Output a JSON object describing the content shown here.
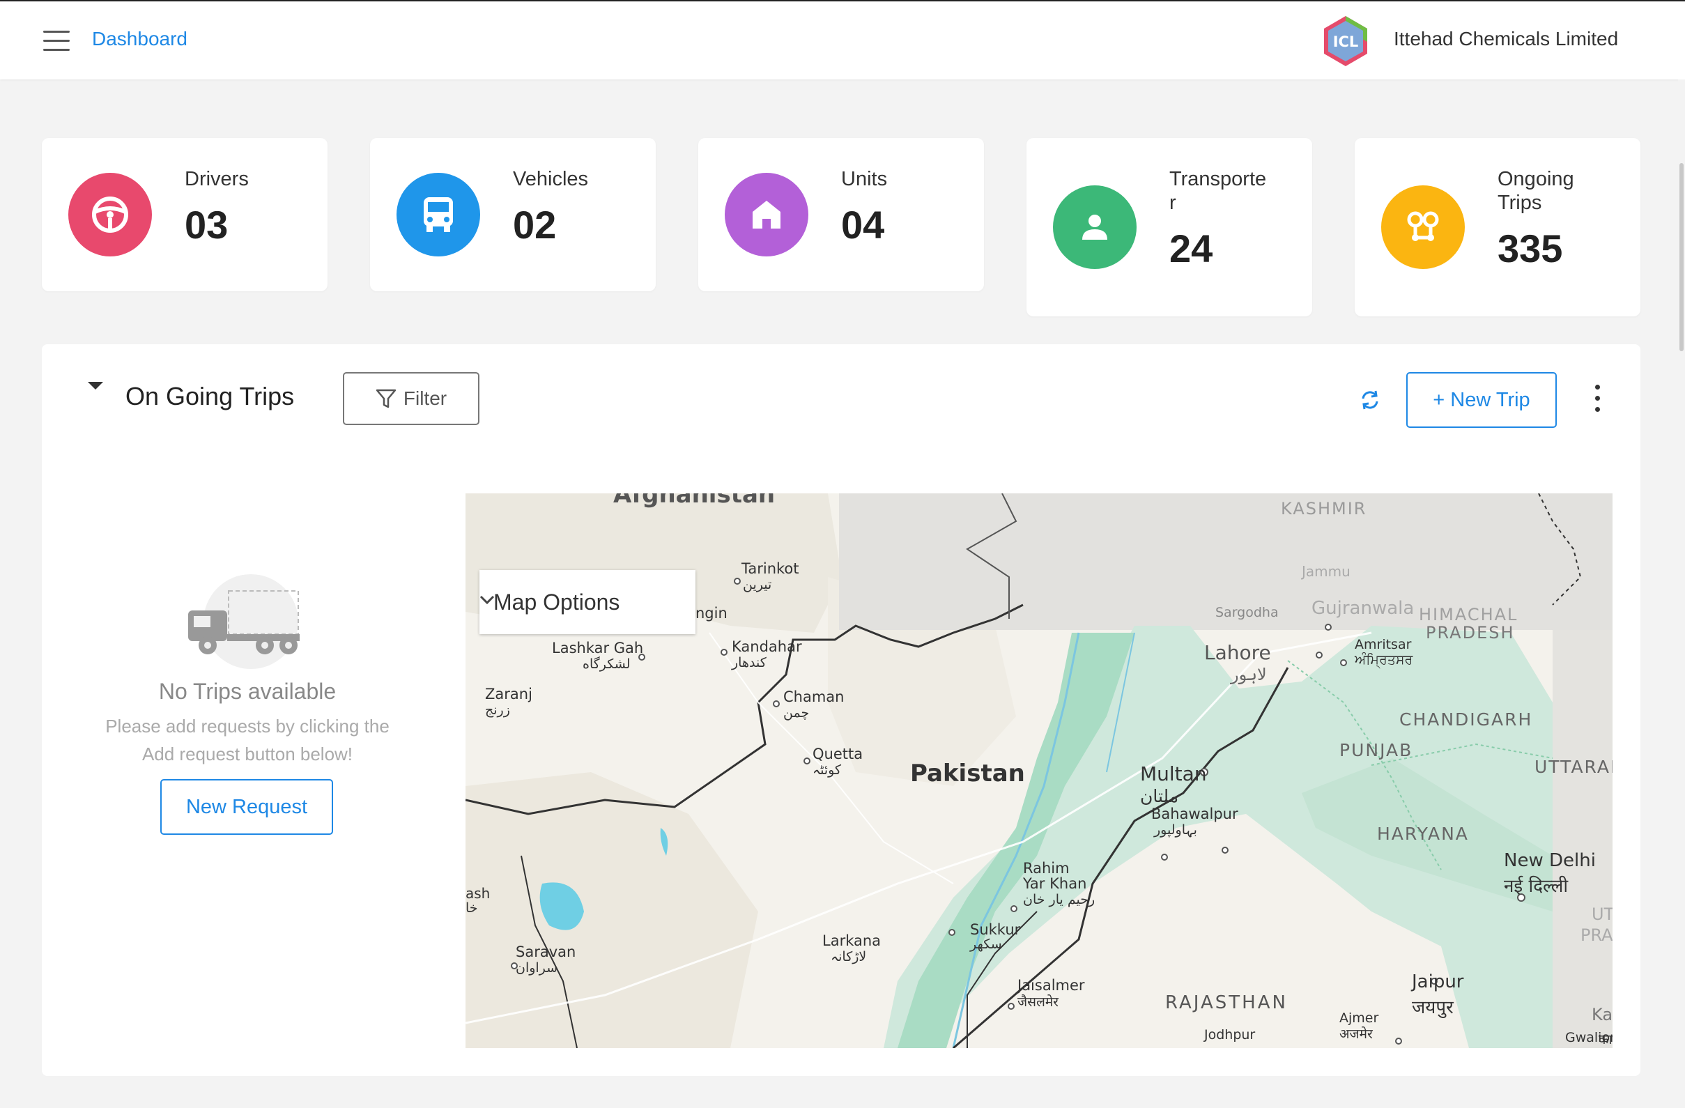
{
  "header": {
    "breadcrumb": "Dashboard",
    "company_logo_text": "ICL",
    "company_name": "Ittehad Chemicals Limited"
  },
  "stats": [
    {
      "label": "Drivers",
      "value": "03",
      "color": "#e8496d",
      "icon": "steering-wheel-icon"
    },
    {
      "label": "Vehicles",
      "value": "02",
      "color": "#1f96ea",
      "icon": "bus-icon"
    },
    {
      "label": "Units",
      "value": "04",
      "color": "#b360d8",
      "icon": "home-icon"
    },
    {
      "label": "Transporte\nr",
      "value": "24",
      "color": "#3cb878",
      "icon": "person-icon"
    },
    {
      "label": "Ongoing\nTrips",
      "value": "335",
      "color": "#fbb511",
      "icon": "route-icon"
    }
  ],
  "trips_panel": {
    "title": "On Going Trips",
    "filter_label": "Filter",
    "new_trip_label": "+ New Trip",
    "empty_title": "No Trips available",
    "empty_text": "Please add requests by clicking the Add request button below!",
    "new_request_label": "New Request"
  },
  "map": {
    "options_label": "Map Options",
    "labels": {
      "afghanistan": "Afghanistan",
      "kashmir": "KASHMIR",
      "jammu": "Jammu",
      "tarinkot": "Tarinkot",
      "tarinkot_ur": "تیرین",
      "gin": "ngin",
      "lashkargah": "Lashkar Gah",
      "lashkargah_ur": "لشکرگاه",
      "kandahar": "Kandahar",
      "kandahar_ur": "کندهار",
      "zaranj": "Zaranj",
      "zaranj_ur": "زرنج",
      "chaman": "Chaman",
      "chaman_ur": "چمن",
      "quetta": "Quetta",
      "quetta_ur": "کوئٹہ",
      "pakistan": "Pakistan",
      "sargodha": "Sargodha",
      "gujranwala": "Gujranwala",
      "himachal": "HIMACHAL",
      "pradesh": "PRADESH",
      "lahore": "Lahore",
      "lahore_ur": "لاہور",
      "amritsar": "Amritsar",
      "amritsar_pa": "ਅੰਮ੍ਰਿਤਸਰ",
      "chandigarh": "CHANDIGARH",
      "punjab": "PUNJAB",
      "uttarakhand": "UTTARAKHA",
      "multan": "Multan",
      "multan_ur": "ملتان",
      "bahawalpur": "Bahawalpur",
      "bahawalpur_ur": "بہاولپور",
      "haryana": "HARYANA",
      "newdelhi": "New Delhi",
      "newdelhi_hi": "नई दिल्ली",
      "rahim1": "Rahim",
      "rahim2": "Yar Khan",
      "rahim_ur": "رحیم یار خان",
      "ash": "ash",
      "ash_ur": "خا",
      "sukkur": "Sukkur",
      "sukkur_ur": "سکھر",
      "larkana": "Larkana",
      "larkana_ur": "لاڑکانہ",
      "saravan": "Saravan",
      "saravan_ur": "سراوان",
      "jaisalmer": "Jaisalmer",
      "jaisalmer_hi": "जैसलमेर",
      "rajasthan": "RAJASTHAN",
      "jaipur": "Jaipur",
      "jaipur_hi": "जयपुर",
      "ajmer": "Ajmer",
      "ajmer_hi": "अजमेर",
      "jodhpur": "Jodhpur",
      "gwalior": "Gwalior",
      "gwalior_hi": "का",
      "kar": "Kar",
      "ut": "UT",
      "pra": "PRA"
    }
  }
}
